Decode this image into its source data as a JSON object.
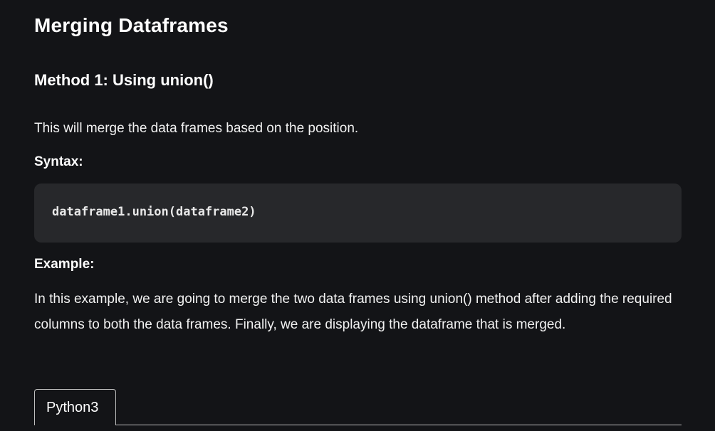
{
  "article": {
    "title": "Merging Dataframes",
    "method_heading": "Method 1: Using union()",
    "intro": "This will merge the data frames based on the position.",
    "syntax_label": "Syntax:",
    "syntax_code": "dataframe1.union(dataframe2)",
    "example_label": "Example:",
    "example_text": "In this example, we are going to merge the two data frames using union() method after adding the required columns to both the data frames. Finally, we are displaying the dataframe that is merged."
  },
  "code_tabs": {
    "active": "Python3",
    "items": [
      "Python3"
    ]
  },
  "colors": {
    "background": "#131417",
    "code_background": "#27282b",
    "text": "#f1f1f1"
  }
}
